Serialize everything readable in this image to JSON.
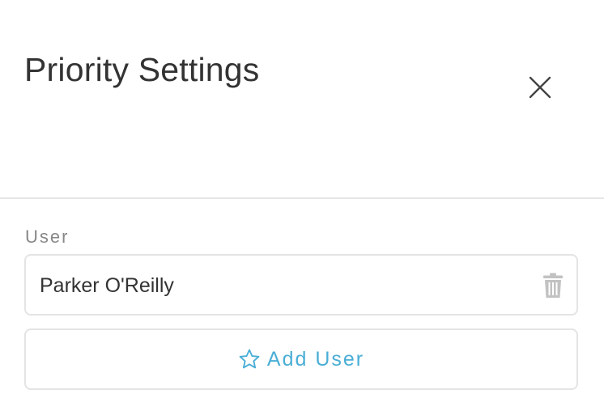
{
  "header": {
    "title": "Priority Settings",
    "close_icon": "close-icon"
  },
  "section": {
    "label": "User"
  },
  "users": [
    {
      "name": "Parker O'Reilly",
      "remove_icon": "trash-icon"
    }
  ],
  "add_button": {
    "label": "Add User",
    "icon": "star-outline-icon"
  },
  "colors": {
    "accent": "#4aaed6",
    "text": "#333333",
    "muted": "#888888",
    "border": "#e4e4e4"
  }
}
